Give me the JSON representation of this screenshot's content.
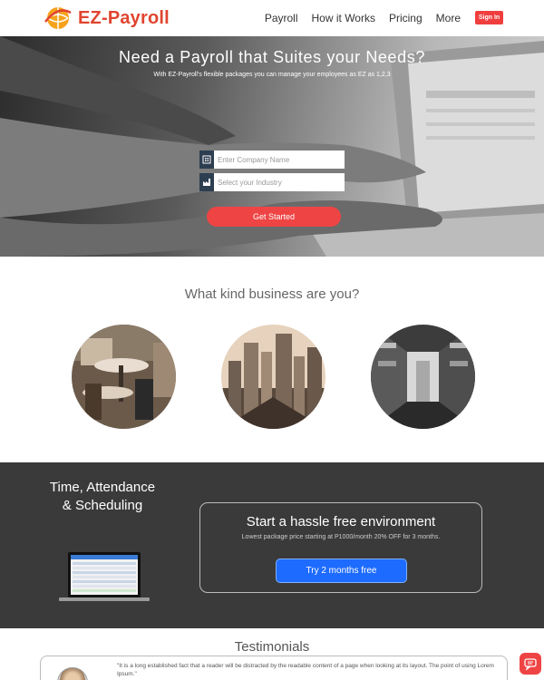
{
  "brand": {
    "name": "EZ-Payroll",
    "accent": "#e0452f"
  },
  "nav": {
    "links": [
      "Payroll",
      "How it Works",
      "Pricing",
      "More"
    ],
    "signin_label": "Sign In"
  },
  "hero": {
    "title": "Need a Payroll that Suites your Needs?",
    "subtitle": "With EZ-Payroll's flexible packages you can manage your employees as EZ as 1,2,3",
    "company_placeholder": "Enter Company Name",
    "industry_placeholder": "Select your Industry",
    "cta_label": "Get Started"
  },
  "business": {
    "title": "What kind business are you?",
    "options": [
      "cafe",
      "city",
      "retail"
    ]
  },
  "features": {
    "title": "Time, Attendance & Scheduling",
    "offer_title": "Start a hassle free environment",
    "offer_subtitle": "Lowest package price starting at P1000/month 20% OFF for 3 months.",
    "offer_button": "Try 2 months free"
  },
  "testimonials": {
    "title": "Testimonials",
    "quote": "\"It is a long established fact that a reader will be distracted by the readable content of a page when looking at its layout. The point of using Lorem Ipsum.\""
  },
  "colors": {
    "cta": "#ef4444",
    "dark": "#3a3a3a",
    "blue_button": "#1e6bff"
  }
}
